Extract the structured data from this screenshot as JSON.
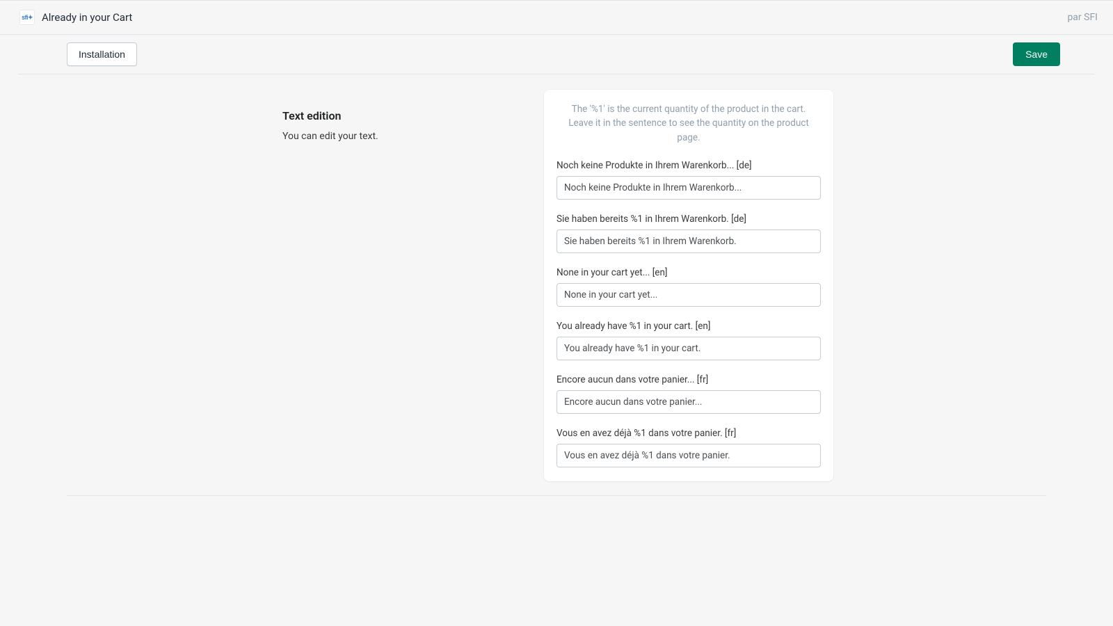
{
  "header": {
    "app_icon_text": "sfi✦",
    "app_title": "Already in your Cart",
    "author_prefix": "par SFI"
  },
  "subbar": {
    "tab_label": "Installation",
    "save_label": "Save"
  },
  "section": {
    "title": "Text edition",
    "desc": "You can edit your text."
  },
  "panel": {
    "help_text": "The '%1' is the current quantity of the product in the cart. Leave it in the sentence to see the quantity on the product page.",
    "fields": {
      "f0": {
        "label": "Noch keine Produkte in Ihrem Warenkorb... [de]",
        "value": "Noch keine Produkte in Ihrem Warenkorb..."
      },
      "f1": {
        "label": "Sie haben bereits %1 in Ihrem Warenkorb. [de]",
        "value": "Sie haben bereits %1 in Ihrem Warenkorb."
      },
      "f2": {
        "label": "None in your cart yet... [en]",
        "value": "None in your cart yet..."
      },
      "f3": {
        "label": "You already have %1 in your cart. [en]",
        "value": "You already have %1 in your cart."
      },
      "f4": {
        "label": "Encore aucun dans votre panier... [fr]",
        "value": "Encore aucun dans votre panier..."
      },
      "f5": {
        "label": "Vous en avez déjà %1 dans votre panier. [fr]",
        "value": "Vous en avez déjà %1 dans votre panier."
      }
    }
  }
}
